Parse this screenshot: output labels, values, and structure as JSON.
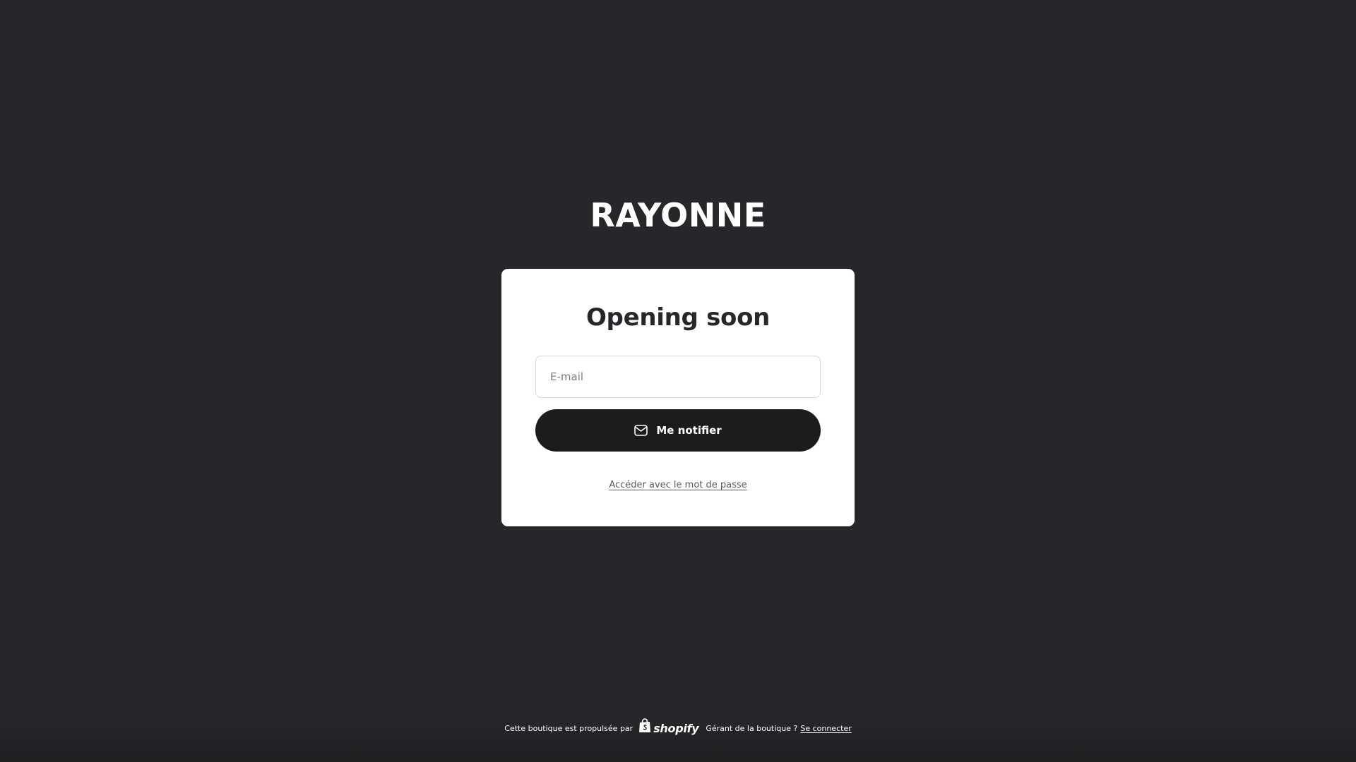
{
  "store": {
    "name": "RAYONNE"
  },
  "card": {
    "title": "Opening soon",
    "email_placeholder": "E-mail",
    "email_value": "",
    "notify_button_label": "Me notifier",
    "notify_icon": "envelope-icon",
    "password_link_label": "Accéder avec le mot de passe"
  },
  "footer": {
    "powered_by_text": "Cette boutique est propulsée par",
    "shopify_wordmark": "shopify",
    "shopify_icon": "shopping-bag-icon",
    "manager_text": "Gérant de la boutique ?",
    "login_link_label": "Se connecter"
  },
  "colors": {
    "background": "#26272a",
    "card_background": "#ffffff",
    "button_background": "#1c1c1c",
    "text_dark": "#26272a",
    "text_light": "#ffffff"
  }
}
